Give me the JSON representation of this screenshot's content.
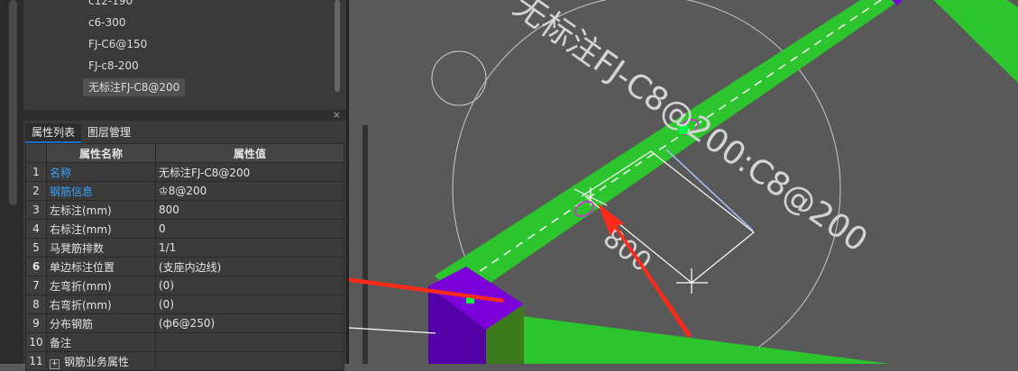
{
  "tree": {
    "items": [
      "c12-190",
      "c6-300",
      "FJ-C6@150",
      "FJ-c8-200",
      "无标注FJ-C8@200"
    ]
  },
  "panel": {
    "close": "×",
    "tabs": [
      "属性列表",
      "图层管理"
    ]
  },
  "table": {
    "headers": {
      "name": "属性名称",
      "value": "属性值"
    },
    "rows": [
      {
        "idx": "1",
        "name": "名称",
        "value": "无标注FJ-C8@200"
      },
      {
        "idx": "2",
        "name": "钢筋信息",
        "value": "♔8@200"
      },
      {
        "idx": "3",
        "name": "左标注(mm)",
        "value": "800"
      },
      {
        "idx": "4",
        "name": "右标注(mm)",
        "value": "0"
      },
      {
        "idx": "5",
        "name": "马凳筋排数",
        "value": "1/1"
      },
      {
        "idx": "6",
        "name": "单边标注位置",
        "value": "(支座内边线)"
      },
      {
        "idx": "7",
        "name": "左弯折(mm)",
        "value": "(0)"
      },
      {
        "idx": "8",
        "name": "右弯折(mm)",
        "value": "(0)"
      },
      {
        "idx": "9",
        "name": "分布钢筋",
        "value": "(ф6@250)"
      },
      {
        "idx": "10",
        "name": "备注",
        "value": ""
      },
      {
        "idx": "11",
        "name": "钢筋业务属性",
        "value": ""
      }
    ],
    "expand_symbol": "+"
  },
  "canvas": {
    "annotation_label": "无标注FJ-C8@200:C8@200",
    "dimension_label": "800",
    "colors": {
      "background": "#595959",
      "slab_strip": "#2dc52d",
      "column": "#7b00d9",
      "arrow": "#ff2a1a",
      "grip": "#00ff3c",
      "highlight": "#c040c0",
      "dimension_line": "#ffffff",
      "guide_line": "#a9bfff"
    }
  }
}
